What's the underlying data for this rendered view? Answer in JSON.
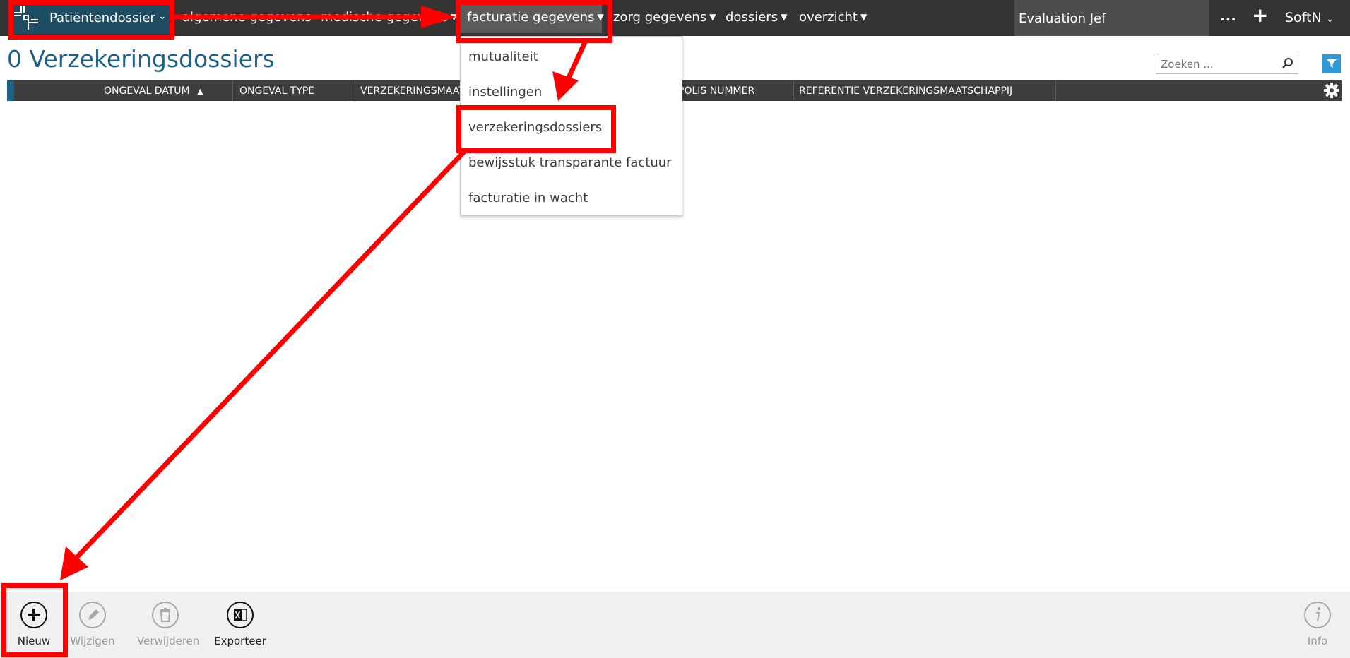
{
  "nav": {
    "brand_label": "Patiëntendossier",
    "items": [
      {
        "label": "algemene gegevens"
      },
      {
        "label": "medische gegevens"
      },
      {
        "label": "facturatie gegevens"
      },
      {
        "label": "zorg gegevens"
      },
      {
        "label": "dossiers"
      },
      {
        "label": "overzicht"
      }
    ],
    "patient_search_value": "Evaluation Jef",
    "more_label": "...",
    "add_label": "+",
    "user_label": "SoftN"
  },
  "page": {
    "title": "0 Verzekeringsdossiers",
    "search_placeholder": "Zoeken ..."
  },
  "table": {
    "columns": [
      {
        "label": "Ongeval datum"
      },
      {
        "label": "Ongeval type"
      },
      {
        "label": "Verzekeringsmaat"
      },
      {
        "label": "Polis nummer"
      },
      {
        "label": "Referentie verzekeringsmaatschappij"
      }
    ],
    "rows": []
  },
  "dropdown": {
    "items": [
      {
        "label": "mutualiteit"
      },
      {
        "label": "instellingen"
      },
      {
        "label": "verzekeringsdossiers"
      },
      {
        "label": "bewijsstuk transparante factuur"
      },
      {
        "label": "facturatie in wacht"
      }
    ]
  },
  "toolbar": {
    "new_label": "Nieuw",
    "edit_label": "Wijzigen",
    "delete_label": "Verwijderen",
    "export_label": "Exporteer",
    "info_label": "Info"
  },
  "colors": {
    "nav_bg": "#343434",
    "brand_bg": "#1e4d63",
    "title_color": "#1f6184",
    "filter_blue": "#2f9ad6",
    "annotation_red": "#ff0000"
  },
  "icons": [
    "logo-icon",
    "chevron-down-icon",
    "caret-down-icon",
    "search-icon",
    "filter-icon",
    "gear-icon",
    "plus-circle-icon",
    "pencil-icon",
    "trash-icon",
    "excel-icon",
    "info-icon"
  ]
}
